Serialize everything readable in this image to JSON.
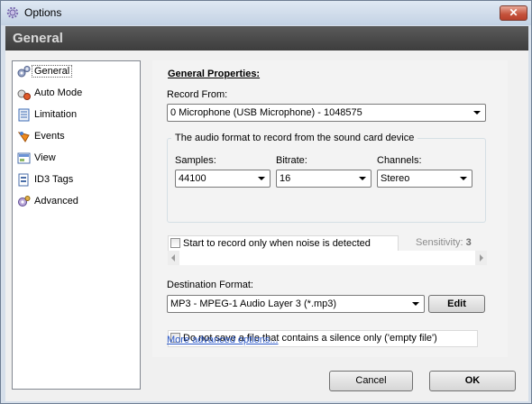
{
  "window": {
    "title": "Options",
    "close_label": "✕"
  },
  "header": {
    "title": "General"
  },
  "nav": {
    "items": [
      {
        "label": "General",
        "icon": "gears-icon",
        "selected": true
      },
      {
        "label": "Auto Mode",
        "icon": "auto-mode-icon",
        "selected": false
      },
      {
        "label": "Limitation",
        "icon": "limitation-icon",
        "selected": false
      },
      {
        "label": "Events",
        "icon": "events-icon",
        "selected": false
      },
      {
        "label": "View",
        "icon": "view-icon",
        "selected": false
      },
      {
        "label": "ID3 Tags",
        "icon": "id3-tags-icon",
        "selected": false
      },
      {
        "label": "Advanced",
        "icon": "advanced-icon",
        "selected": false
      }
    ]
  },
  "general": {
    "section_title": "General Properties:",
    "record_from": {
      "label": "Record From:",
      "value": "0 Microphone (USB Microphone) - 1048575"
    },
    "format_group": {
      "legend": "The audio format to record from the sound card device",
      "samples": {
        "label": "Samples:",
        "value": "44100"
      },
      "bitrate": {
        "label": "Bitrate:",
        "value": "16"
      },
      "channels": {
        "label": "Channels:",
        "value": "Stereo"
      }
    },
    "noise": {
      "label": "Start to record only when noise is detected",
      "checked": false
    },
    "sensitivity": {
      "label": "Sensitivity:",
      "value": "3"
    },
    "destination": {
      "label": "Destination Format:",
      "value": "MP3 - MPEG-1 Audio Layer 3 (*.mp3)",
      "edit_label": "Edit"
    },
    "silence": {
      "label": "Do not save a file that contains a silence only ('empty file')",
      "checked": false
    },
    "advanced_link": "More advanced options..."
  },
  "footer": {
    "cancel_label": "Cancel",
    "ok_label": "OK"
  }
}
